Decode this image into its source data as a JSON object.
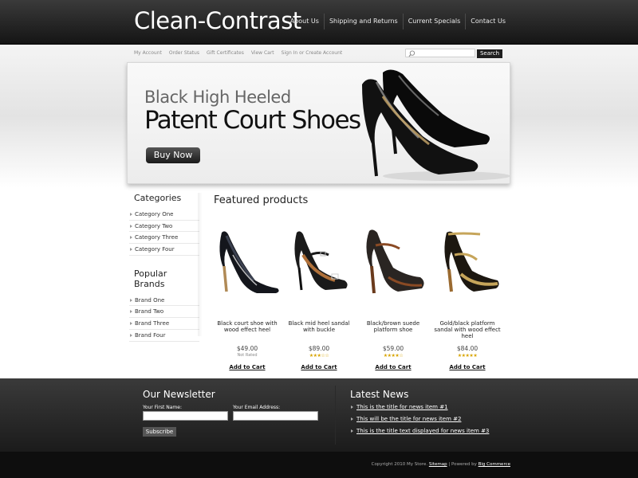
{
  "header": {
    "logo": "Clean-Contrast",
    "nav": [
      "About Us",
      "Shipping and Returns",
      "Current Specials",
      "Contact Us"
    ]
  },
  "subnav": {
    "links": [
      "My Account",
      "Order Status",
      "Gift Certificates",
      "View Cart",
      "Sign In or Create Account"
    ],
    "search_placeholder": "",
    "search_button": "Search"
  },
  "banner": {
    "subtitle": "Black High Heeled",
    "title": "Patent Court Shoes",
    "button": "Buy Now"
  },
  "sidebar": {
    "categories_title": "Categories",
    "categories": [
      "Category One",
      "Category Two",
      "Category Three",
      "Category Four"
    ],
    "brands_title": "Popular Brands",
    "brands": [
      "Brand One",
      "Brand Two",
      "Brand Three",
      "Brand Four"
    ]
  },
  "featured": {
    "title": "Featured products",
    "products": [
      {
        "name": "Black court shoe with wood effect heel",
        "price": "$49.00",
        "rating": "Not Rated",
        "stars": 0,
        "add": "Add to Cart"
      },
      {
        "name": "Black mid heel sandal with buckle",
        "price": "$89.00",
        "rating": "",
        "stars": 3,
        "add": "Add to Cart"
      },
      {
        "name": "Black/brown suede platform shoe",
        "price": "$59.00",
        "rating": "",
        "stars": 4,
        "add": "Add to Cart"
      },
      {
        "name": "Gold/black platform sandal with wood effect heel",
        "price": "$84.00",
        "rating": "",
        "stars": 5,
        "add": "Add to Cart"
      }
    ]
  },
  "newsletter": {
    "title": "Our Newsletter",
    "first_name_label": "Your First Name:",
    "email_label": "Your Email Address:",
    "subscribe": "Subscribe"
  },
  "news": {
    "title": "Latest News",
    "items": [
      "This is the title for news item #1",
      "This will be the title for news item #2",
      "This is the title text displayed for news item #3"
    ]
  },
  "footer": {
    "copyright": "Copyright 2010 My Store.",
    "sitemap": "Sitemap",
    "powered": "| Powered by",
    "bigcommerce": "Big Commerce"
  },
  "colors": {
    "header_bg": "#1f1f1f",
    "accent": "#d8a400",
    "page_bg": "#ffffff"
  }
}
